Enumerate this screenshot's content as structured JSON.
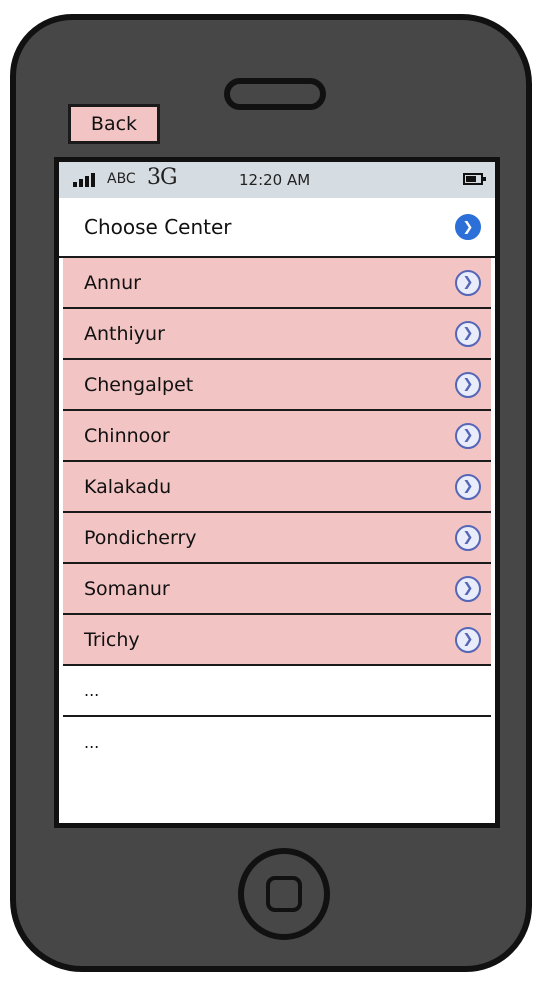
{
  "back_button": {
    "label": "Back"
  },
  "status_bar": {
    "carrier": "ABC",
    "network": "3G",
    "time": "12:20 AM"
  },
  "list": {
    "title": "Choose Center",
    "items": [
      {
        "label": "Annur"
      },
      {
        "label": "Anthiyur"
      },
      {
        "label": "Chengalpet"
      },
      {
        "label": "Chinnoor"
      },
      {
        "label": "Kalakadu"
      },
      {
        "label": "Pondicherry"
      },
      {
        "label": "Somanur"
      },
      {
        "label": "Trichy"
      }
    ],
    "more_items": [
      {
        "label": "..."
      },
      {
        "label": "..."
      }
    ]
  },
  "colors": {
    "row_highlight": "#f2c4c4",
    "phone_body": "#474747",
    "status_bar": "#d6dde2",
    "chevron_accent": "#2c6fd8"
  }
}
